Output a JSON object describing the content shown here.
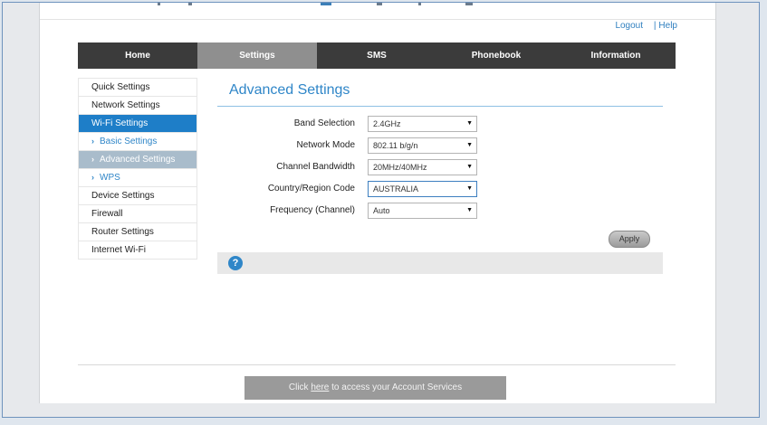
{
  "header": {
    "logout_label": "Logout",
    "help_label": "Help",
    "separator": "|"
  },
  "nav": {
    "tabs": [
      {
        "label": "Home"
      },
      {
        "label": "Settings"
      },
      {
        "label": "SMS"
      },
      {
        "label": "Phonebook"
      },
      {
        "label": "Information"
      }
    ],
    "active": "Settings"
  },
  "sidebar": {
    "items": [
      {
        "label": "Quick Settings"
      },
      {
        "label": "Network Settings"
      },
      {
        "label": "Wi-Fi Settings"
      },
      {
        "label": "Basic Settings"
      },
      {
        "label": "Advanced Settings"
      },
      {
        "label": "WPS"
      },
      {
        "label": "Device Settings"
      },
      {
        "label": "Firewall"
      },
      {
        "label": "Router Settings"
      },
      {
        "label": "Internet Wi-Fi"
      }
    ],
    "chevron": "›"
  },
  "main": {
    "title": "Advanced Settings",
    "fields": [
      {
        "label": "Band Selection",
        "value": "2.4GHz"
      },
      {
        "label": "Network Mode",
        "value": "802.11 b/g/n"
      },
      {
        "label": "Channel Bandwidth",
        "value": "20MHz/40MHz"
      },
      {
        "label": "Country/Region Code",
        "value": "AUSTRALIA"
      },
      {
        "label": "Frequency (Channel)",
        "value": "Auto"
      }
    ],
    "dropdown_arrow": "▼",
    "apply_label": "Apply",
    "help_icon": "?"
  },
  "footer": {
    "prefix": "Click ",
    "link": "here",
    "suffix": " to access your Account Services"
  },
  "colors": {
    "accent": "#2f86c8",
    "nav_bg": "#3b3b3b",
    "nav_active": "#8f8f8f",
    "sidebar_active": "#1e7ec8"
  }
}
